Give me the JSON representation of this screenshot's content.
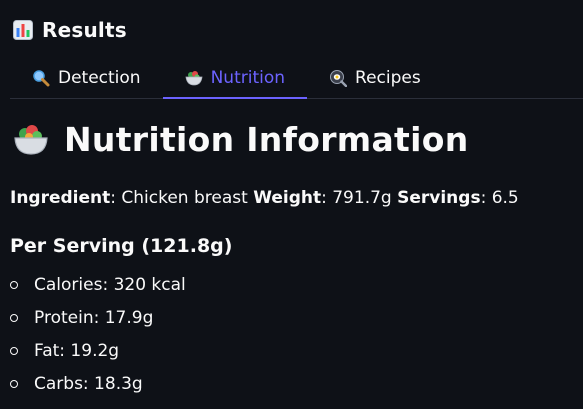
{
  "header": {
    "title": "Results",
    "icon": "bar-chart-icon"
  },
  "tabs": [
    {
      "label": "Detection",
      "icon": "magnifier-icon",
      "active": false
    },
    {
      "label": "Nutrition",
      "icon": "salad-bowl-icon",
      "active": true
    },
    {
      "label": "Recipes",
      "icon": "frying-pan-icon",
      "active": false
    }
  ],
  "section": {
    "title": "Nutrition Information",
    "icon": "salad-bowl-icon"
  },
  "meta": {
    "ingredient_label": "Ingredient",
    "ingredient_value": ": Chicken breast ",
    "weight_label": "Weight",
    "weight_value": ": 791.7g ",
    "servings_label": "Servings",
    "servings_value": ": 6.5"
  },
  "per_serving": {
    "title": "Per Serving (121.8g)",
    "items": [
      "Calories: 320 kcal",
      "Protein: 17.9g",
      "Fat: 19.2g",
      "Carbs: 18.3g"
    ]
  },
  "colors": {
    "background": "#0e1117",
    "text": "#fafafa",
    "accent": "#6c63ff",
    "divider": "#2b2f3a"
  }
}
